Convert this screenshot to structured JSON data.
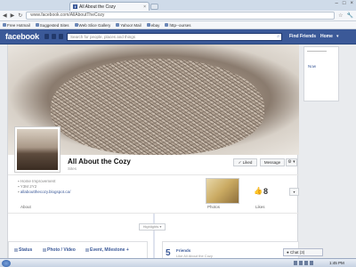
{
  "browser": {
    "tab_title": "All About the Cozy",
    "tab_close": "×",
    "address": "www.facebook.com/AllAboutTheCozy",
    "window_controls": [
      "–",
      "□",
      "×"
    ],
    "bookmarks": [
      "Free Hotmail",
      "Suggested Sites",
      "Web Slice Gallery",
      "Yahoo! Mail",
      "ebay",
      "http--ourses"
    ]
  },
  "fb_header": {
    "logo": "facebook",
    "search_placeholder": "Search for people, places and things",
    "find_friends": "Find Friends",
    "home": "Home",
    "home_arrow": "▾"
  },
  "profile": {
    "name": "All About the Cozy",
    "category": "Sites",
    "liked_button": "✓ Liked",
    "message_button": "Message",
    "gear_button": "⚙ ▾",
    "info": [
      "Home Improvement",
      "Y3M 2Y2",
      "allaboutthecozy.blogspot.ca/"
    ],
    "about_label": "About",
    "photos_label": "Photos",
    "likes_label": "Likes",
    "likes_count": "8",
    "more_button": "▾"
  },
  "timeline": {
    "highlights": "Highlights ▾",
    "composer": {
      "status": "Status",
      "photo": "Photo / Video",
      "event": "Event, Milestone +"
    },
    "friends": {
      "count": "5",
      "label": "Friends",
      "sub": "Like All About the Cozy"
    }
  },
  "sidebar": {
    "now": "Now"
  },
  "chat": {
    "label": "Chat (3)"
  },
  "taskbar": {
    "clock": "1:45 PM"
  },
  "colors": {
    "fb_blue": "#3b5998",
    "background": "#e9ebee"
  }
}
